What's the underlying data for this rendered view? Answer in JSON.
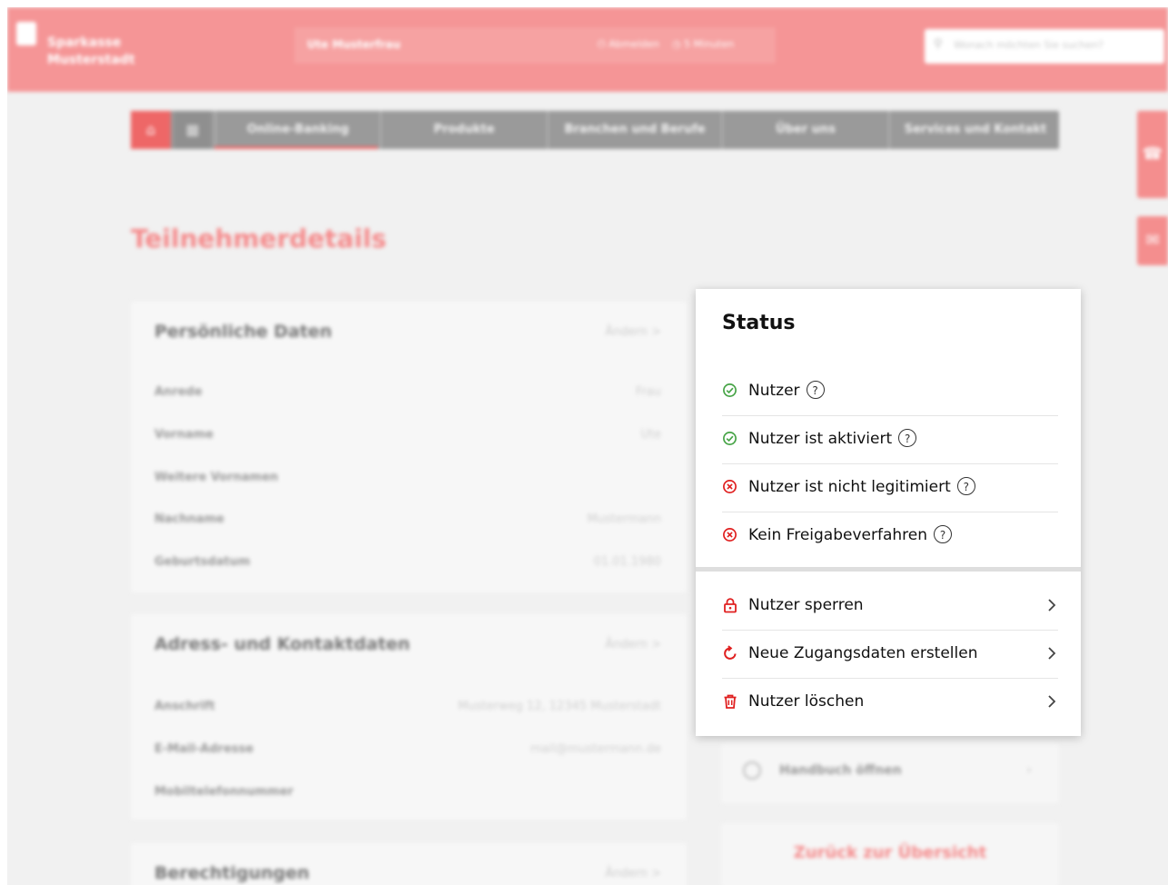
{
  "header": {
    "brand_line1": "Sparkasse",
    "brand_line2": "Musterstadt",
    "user_name": "Ute Musterfrau",
    "logout_label": "⏻ Abmelden",
    "timer_label": "◷ 5 Minuten",
    "search_placeholder": "Wonach möchten Sie suchen?"
  },
  "nav": {
    "tabs": [
      {
        "label": "Online-Banking"
      },
      {
        "label": "Produkte"
      },
      {
        "label": "Branchen und Berufe"
      },
      {
        "label": "Über uns"
      },
      {
        "label": "Services und Kontakt"
      }
    ]
  },
  "page": {
    "title": "Teilnehmerdetails"
  },
  "personal": {
    "title": "Persönliche Daten",
    "edit": "Ändern  >",
    "rows": [
      {
        "label": "Anrede",
        "value": "Frau"
      },
      {
        "label": "Vorname",
        "value": "Ute"
      },
      {
        "label": "Weitere Vornamen",
        "value": ""
      },
      {
        "label": "Nachname",
        "value": "Mustermann"
      },
      {
        "label": "Geburtsdatum",
        "value": "01.01.1980"
      }
    ]
  },
  "address": {
    "title": "Adress- und Kontaktdaten",
    "edit": "Ändern  >",
    "rows": [
      {
        "label": "Anschrift",
        "value": "Musterweg 12, 12345 Musterstadt"
      },
      {
        "label": "E-Mail-Adresse",
        "value": "mail@mustermann.de"
      },
      {
        "label": "Mobiltelefonnummer",
        "value": ""
      }
    ]
  },
  "permissions": {
    "title": "Berechtigungen",
    "edit": "Ändern  >"
  },
  "background_right": {
    "handbook": "Handbuch öffnen",
    "back": "Zurück zur Übersicht"
  },
  "status": {
    "title": "Status",
    "items": [
      {
        "label": "Nutzer",
        "state": "ok"
      },
      {
        "label": "Nutzer ist aktiviert",
        "state": "ok"
      },
      {
        "label": "Nutzer ist nicht legitimiert",
        "state": "error"
      },
      {
        "label": "Kein Freigabeverfahren",
        "state": "error"
      }
    ]
  },
  "actions": {
    "items": [
      {
        "label": "Nutzer sperren",
        "icon": "lock-icon"
      },
      {
        "label": "Neue Zugangsdaten erstellen",
        "icon": "refresh-icon"
      },
      {
        "label": "Nutzer löschen",
        "icon": "trash-icon"
      }
    ]
  },
  "colors": {
    "brand_red": "#f59596",
    "ok_green": "#47a447",
    "error_red": "#e02020",
    "text_dark": "#111111"
  }
}
